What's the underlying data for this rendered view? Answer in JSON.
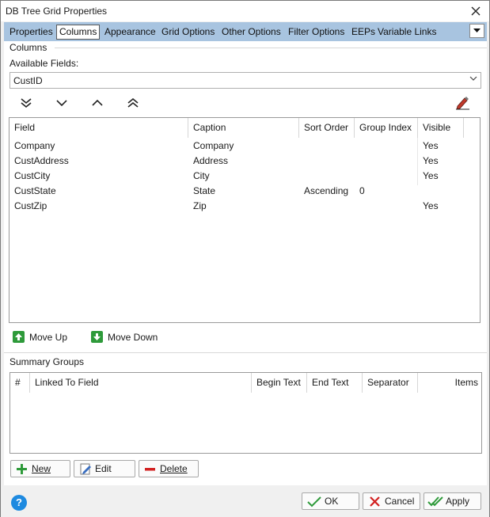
{
  "window": {
    "title": "DB Tree Grid Properties"
  },
  "tabs": [
    {
      "label": "Properties"
    },
    {
      "label": "Columns",
      "active": true
    },
    {
      "label": "Appearance"
    },
    {
      "label": "Grid Options"
    },
    {
      "label": "Other Options"
    },
    {
      "label": "Filter Options"
    },
    {
      "label": "EEPs"
    },
    {
      "label": "Variable Links"
    }
  ],
  "columns_section": {
    "group_label": "Columns",
    "available_fields_label": "Available Fields:",
    "available_fields_value": "CustID",
    "headers": [
      "Field",
      "Caption",
      "Sort Order",
      "Group Index",
      "Visible"
    ],
    "rows": [
      [
        "Company",
        "Company",
        "",
        "",
        "Yes"
      ],
      [
        "CustAddress",
        "Address",
        "",
        "",
        "Yes"
      ],
      [
        "CustCity",
        "City",
        "",
        "",
        "Yes"
      ],
      [
        "CustState",
        "State",
        "Ascending",
        "0",
        ""
      ],
      [
        "CustZip",
        "Zip",
        "",
        "",
        "Yes"
      ]
    ],
    "move_up_label": "Move Up",
    "move_down_label": "Move Down"
  },
  "summary_section": {
    "group_label": "Summary Groups",
    "headers": [
      "#",
      "Linked To Field",
      "Begin Text",
      "End Text",
      "Separator",
      "Items"
    ],
    "new_label": "New",
    "edit_label": "Edit",
    "delete_label": "Delete"
  },
  "footer": {
    "ok_label": "OK",
    "cancel_label": "Cancel",
    "apply_label": "Apply"
  },
  "colors": {
    "tab_bar": "#a8c4e0",
    "help": "#1e8ae0",
    "ok_check": "#2e9a3a",
    "cancel_x": "#d22020"
  }
}
